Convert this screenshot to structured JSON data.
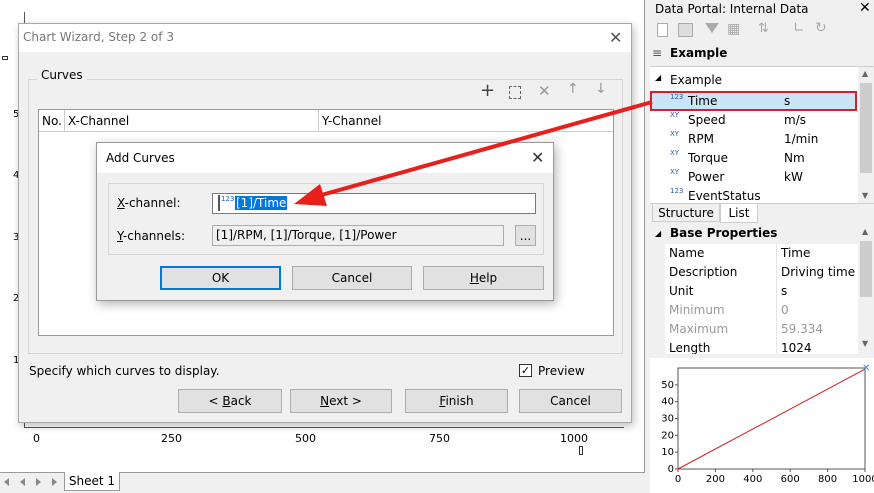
{
  "wizard": {
    "title": "Chart Wizard, Step 2 of 3",
    "group_label": "Curves",
    "columns": [
      "No.",
      "X-Channel",
      "Y-Channel"
    ],
    "hint": "Specify which curves to display.",
    "preview_label": "Preview",
    "preview_checked": true,
    "back_label": "< Back",
    "next_label": "Next >",
    "finish_label": "Finish",
    "cancel_label": "Cancel"
  },
  "add_curves": {
    "title": "Add Curves",
    "x_label": "X-channel:",
    "x_icon_text": "123",
    "x_value": "[1]/Time",
    "y_label": "Y-channels:",
    "y_value": "[1]/RPM, [1]/Torque, [1]/Power",
    "browse_label": "...",
    "ok_label": "OK",
    "cancel_label": "Cancel",
    "help_label": "Help"
  },
  "background_chart": {
    "x_ticks": [
      "0",
      "250",
      "500",
      "750",
      "1000"
    ],
    "y_ticks": [
      "5",
      "4",
      "3",
      "2",
      "1"
    ]
  },
  "sheet": {
    "tab": "Sheet 1"
  },
  "portal": {
    "title": "Data Portal: Internal Data",
    "root": "Example",
    "group": "Example",
    "channels": [
      {
        "icon": "123",
        "name": "Time",
        "unit": "s",
        "selected": true
      },
      {
        "icon": "XY",
        "name": "Speed",
        "unit": "m/s"
      },
      {
        "icon": "XY",
        "name": "RPM",
        "unit": "1/min"
      },
      {
        "icon": "XY",
        "name": "Torque",
        "unit": "Nm"
      },
      {
        "icon": "XY",
        "name": "Power",
        "unit": "kW"
      },
      {
        "icon": "123",
        "name": "EventStatus",
        "unit": ""
      }
    ],
    "tabs": [
      "Structure",
      "List"
    ],
    "props_header": "Base Properties",
    "properties": [
      {
        "key": "Name",
        "value": "Time",
        "enabled": true
      },
      {
        "key": "Description",
        "value": "Driving time",
        "enabled": true
      },
      {
        "key": "Unit",
        "value": "s",
        "enabled": true
      },
      {
        "key": "Minimum",
        "value": "0",
        "enabled": false
      },
      {
        "key": "Maximum",
        "value": "59.334",
        "enabled": false
      },
      {
        "key": "Length",
        "value": "1024",
        "enabled": true
      }
    ]
  },
  "preview_chart": {
    "x_ticks": [
      "0",
      "200",
      "400",
      "600",
      "800",
      "1000"
    ],
    "y_ticks": [
      "50",
      "40",
      "30",
      "20",
      "10",
      "0"
    ]
  },
  "chart_data": {
    "type": "line",
    "x": [
      0,
      1000
    ],
    "series": [
      {
        "values": [
          0,
          59.334
        ]
      }
    ],
    "xlim": [
      0,
      1000
    ],
    "ylim": [
      0,
      60
    ],
    "color": "#d21e1e"
  },
  "colors": {
    "accent": "#0078d7",
    "arrow": "#e8201c",
    "selection_box": "#d0202a"
  }
}
